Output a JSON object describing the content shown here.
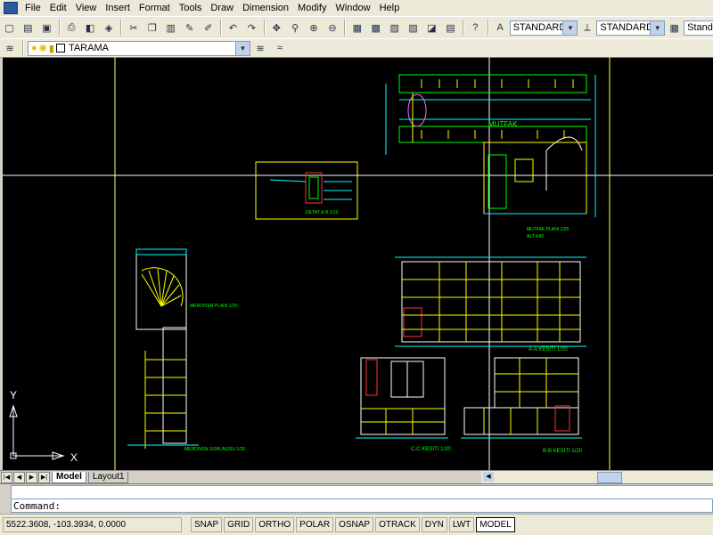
{
  "menu": [
    "File",
    "Edit",
    "View",
    "Insert",
    "Format",
    "Tools",
    "Draw",
    "Dimension",
    "Modify",
    "Window",
    "Help"
  ],
  "toolbar": {
    "text_style": "STANDARD",
    "dim_style": "STANDARD",
    "table_style": "Stand"
  },
  "layers": {
    "current_layer": "TARAMA"
  },
  "drawing": {
    "kitchen_title": "MUTFAK",
    "kitchen_plan_label": "MUTFAK PLANI 1/20",
    "kitchen_plan_sub": "ALT KAT",
    "detail_label": "DETAY A-B 1/10",
    "stair_plan_label": "MERDIVEN PLANI 1/20",
    "stair_view_label": "MERDIVEN GORUNUSU 1/20",
    "section_aa": "A-A KESITI 1/20",
    "section_cc": "C-C KESITI 1/20",
    "section_bb": "B-B KESITI 1/20",
    "ucs_y": "Y",
    "ucs_x": "X"
  },
  "tabs": {
    "model": "Model",
    "layout": "Layout1"
  },
  "command": {
    "prompt": "Command:"
  },
  "status": {
    "coords": "5522.3608, -103.3934, 0.0000",
    "toggles": [
      {
        "label": "SNAP",
        "on": false
      },
      {
        "label": "GRID",
        "on": false
      },
      {
        "label": "ORTHO",
        "on": false
      },
      {
        "label": "POLAR",
        "on": false
      },
      {
        "label": "OSNAP",
        "on": false
      },
      {
        "label": "OTRACK",
        "on": false
      },
      {
        "label": "DYN",
        "on": false
      },
      {
        "label": "LWT",
        "on": false
      },
      {
        "label": "MODEL",
        "on": true
      }
    ]
  }
}
